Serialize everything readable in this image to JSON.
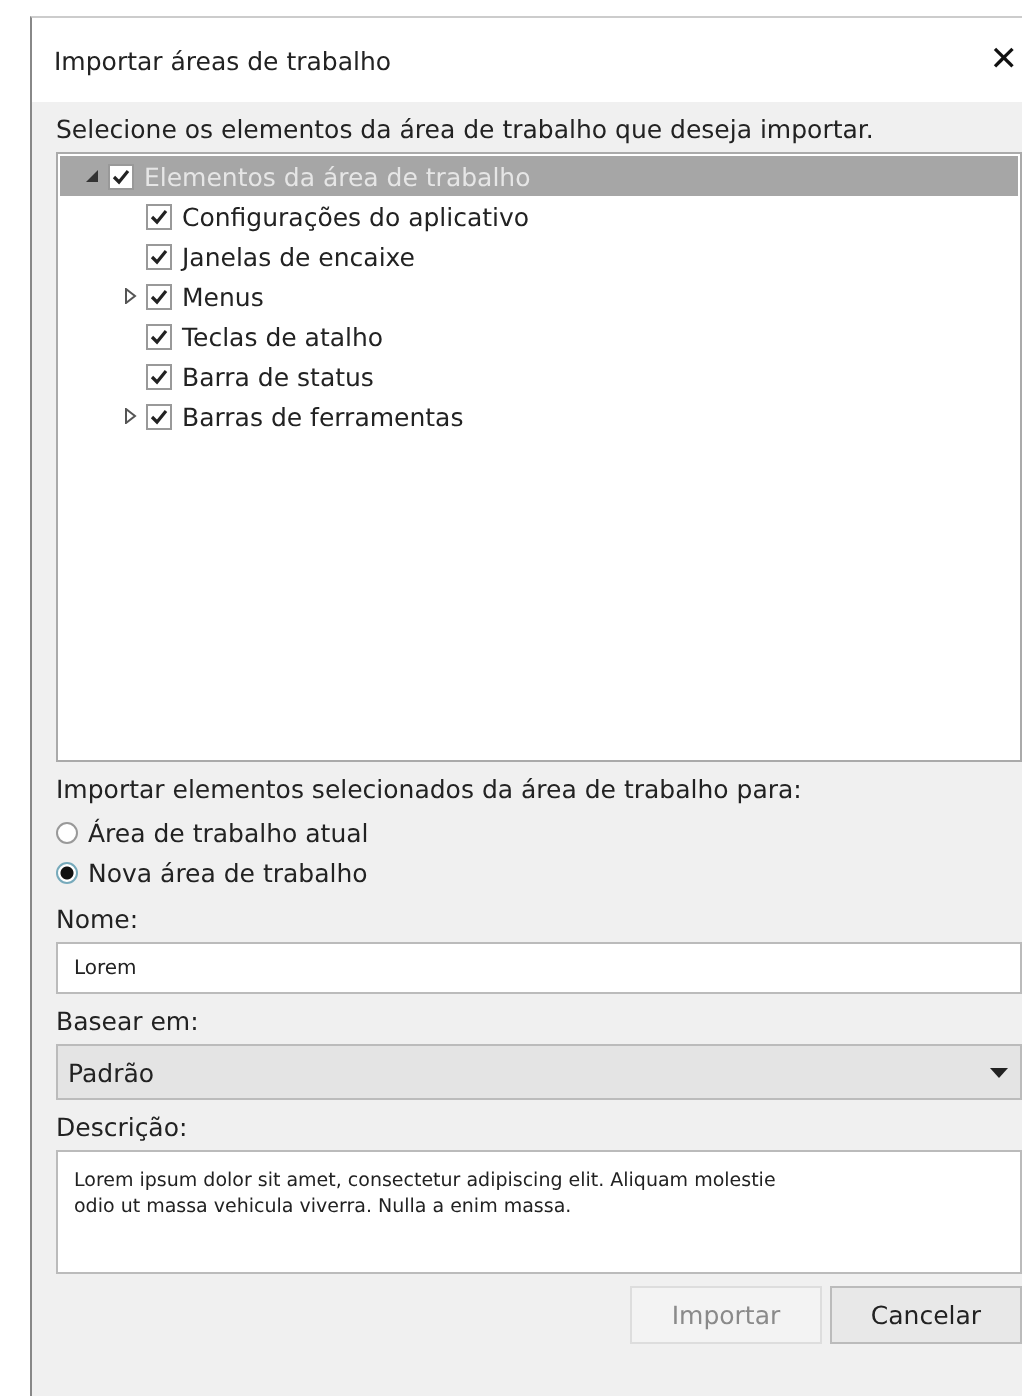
{
  "window": {
    "title": "Importar áreas de trabalho",
    "close": "✕"
  },
  "instruction": "Selecione os elementos da área de trabalho que deseja importar.",
  "tree": [
    {
      "label": "Elementos da área de trabalho",
      "kind": "branch",
      "expanded": true,
      "checked": true,
      "selected": true,
      "children": [
        {
          "label": "Configurações do aplicativo",
          "kind": "leaf",
          "checked": true,
          "selected": false
        },
        {
          "label": "Janelas de encaixe",
          "kind": "leaf",
          "checked": true,
          "selected": false
        },
        {
          "label": "Menus",
          "kind": "branch",
          "expanded": false,
          "checked": true,
          "selected": false
        },
        {
          "label": "Teclas de atalho",
          "kind": "leaf",
          "checked": true,
          "selected": false
        },
        {
          "label": "Barra de status",
          "kind": "leaf",
          "checked": true,
          "selected": false
        },
        {
          "label": "Barras de ferramentas",
          "kind": "branch",
          "expanded": false,
          "checked": true,
          "selected": false
        }
      ]
    }
  ],
  "target_label": "Importar elementos selecionados da área de trabalho para:",
  "targets": [
    {
      "label": "Área de trabalho atual",
      "selected": false
    },
    {
      "label": "Nova área de trabalho",
      "selected": true
    }
  ],
  "name": {
    "label": "Nome:",
    "value": "Lorem"
  },
  "base": {
    "label": "Basear em:",
    "value": "Padrão"
  },
  "description": {
    "label": "Descrição:",
    "value": "Lorem ipsum dolor sit amet, consectetur adipiscing elit. Aliquam molestie\nodio ut massa vehicula viverra. Nulla a enim massa."
  },
  "buttons": [
    {
      "label": "Importar",
      "disabled": true
    },
    {
      "label": "Cancelar",
      "disabled": false
    }
  ]
}
